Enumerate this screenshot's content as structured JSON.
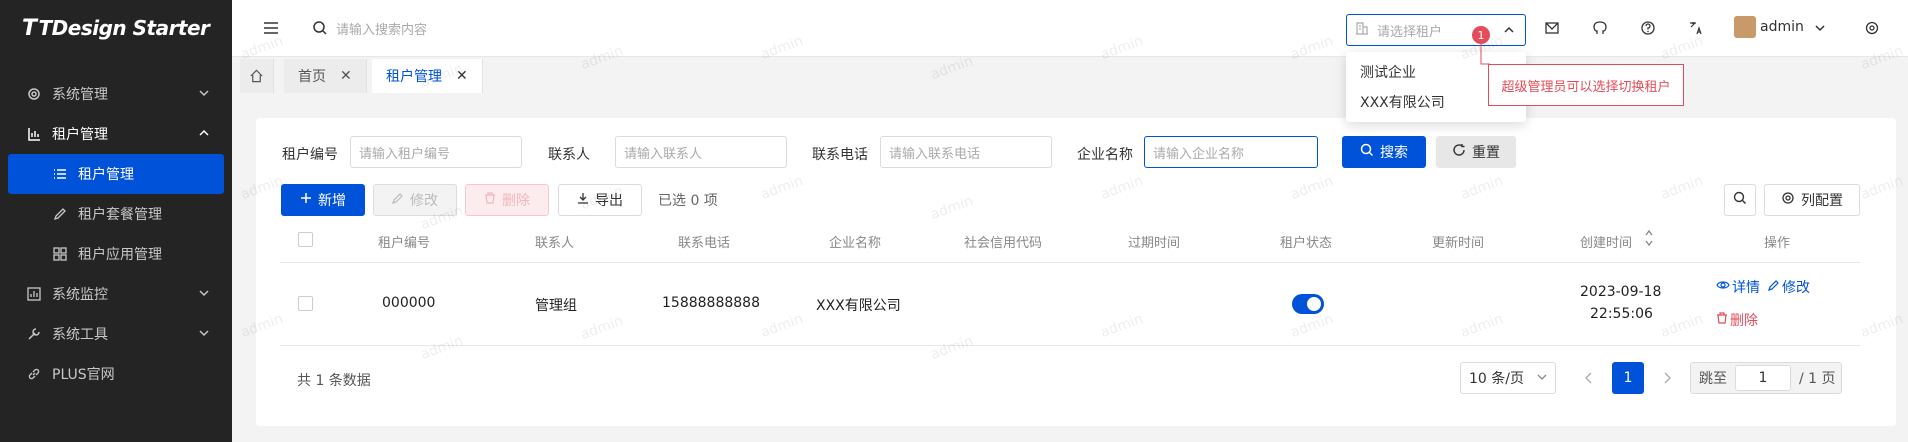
{
  "brand": {
    "logo_mark": "T",
    "name": "TDesign Starter"
  },
  "sidebar": {
    "items": [
      {
        "label": "系统管理",
        "icon": "gear-icon"
      },
      {
        "label": "租户管理",
        "icon": "chart-bar-icon"
      },
      {
        "label": "租户管理",
        "icon": "list-icon"
      },
      {
        "label": "租户套餐管理",
        "icon": "pencil-icon"
      },
      {
        "label": "租户应用管理",
        "icon": "grid-icon"
      },
      {
        "label": "系统监控",
        "icon": "monitor-icon"
      },
      {
        "label": "系统工具",
        "icon": "wrench-icon"
      },
      {
        "label": "PLUS官网",
        "icon": "link-icon"
      }
    ]
  },
  "header": {
    "search_placeholder": "请输入搜索内容",
    "tenant_placeholder": "请选择租户",
    "user": "admin",
    "badge": "1"
  },
  "tenant_dropdown": {
    "options": [
      "测试企业",
      "XXX有限公司"
    ]
  },
  "tooltip": "超级管理员可以选择切换租户",
  "tabs": [
    {
      "label": "首页"
    },
    {
      "label": "租户管理"
    }
  ],
  "filters": {
    "tenant_id": {
      "label": "租户编号",
      "placeholder": "请输入租户编号"
    },
    "contact": {
      "label": "联系人",
      "placeholder": "请输入联系人"
    },
    "phone": {
      "label": "联系电话",
      "placeholder": "请输入联系电话"
    },
    "company": {
      "label": "企业名称",
      "placeholder": "请输入企业名称"
    },
    "search": "搜索",
    "reset": "重置"
  },
  "toolbar": {
    "add": "新增",
    "edit": "修改",
    "delete": "删除",
    "export": "导出",
    "selected": "已选 0 项",
    "columns": "列配置"
  },
  "table": {
    "headers": [
      "租户编号",
      "联系人",
      "联系电话",
      "企业名称",
      "社会信用代码",
      "过期时间",
      "租户状态",
      "更新时间",
      "创建时间",
      "操作"
    ],
    "rows": [
      {
        "tenant_id": "000000",
        "contact": "管理组",
        "phone": "15888888888",
        "company": "XXX有限公司",
        "credit_code": "",
        "expire": "",
        "status_on": true,
        "updated": "",
        "created_date": "2023-09-18",
        "created_time": "22:55:06",
        "actions": [
          "详情",
          "修改",
          "删除"
        ]
      }
    ]
  },
  "pagination": {
    "total": "共 1 条数据",
    "page_size": "10 条/页",
    "current": "1",
    "jump_label": "跳至",
    "jump_value": "1",
    "pages": "/ 1 页"
  },
  "watermark": "admin",
  "colors": {
    "primary": "#0052d9",
    "danger": "#e34d59",
    "sidebar_bg": "#242424"
  }
}
